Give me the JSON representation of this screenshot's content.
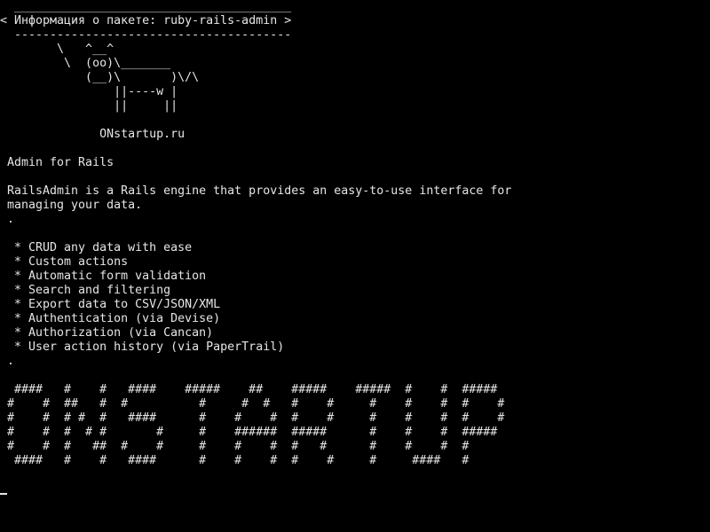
{
  "terminal": {
    "bubble": {
      "top_border": " _______________________________________",
      "title_line": "< Информация о пакете: ruby-rails-admin >",
      "bottom_border": " ---------------------------------------"
    },
    "cow": [
      "       \\   ^__^",
      "        \\  (oo)\\_______",
      "           (__)\\       )\\/\\",
      "               ||----w |",
      "               ||     ||"
    ],
    "brand": "             ONstartup.ru",
    "package_title": "Admin for Rails",
    "description": [
      "RailsAdmin is a Rails engine that provides an easy-to-use interface for",
      "managing your data.",
      "."
    ],
    "features": [
      " * CRUD any data with ease",
      " * Custom actions",
      " * Automatic form validation",
      " * Search and filtering",
      " * Export data to CSV/JSON/XML",
      " * Authentication (via Devise)",
      " * Authorization (via Cancan)",
      " * User action history (via PaperTrail)",
      "."
    ],
    "banner": [
      " ####   #    #   ####    #####    ##    #####    #####  #    #  #####",
      "#    #  ##   #  #          #     #  #   #    #     #    #    #  #    #",
      "#    #  # #  #   ####      #    #    #  #    #     #    #    #  #    #",
      "#    #  #  # #       #     #    ######  #####      #    #    #  #####",
      "#    #  #   ##  #    #     #    #    #  #   #      #    #    #  #",
      " ####   #    #   ####      #    #    #  #    #     #     ####   #"
    ]
  }
}
